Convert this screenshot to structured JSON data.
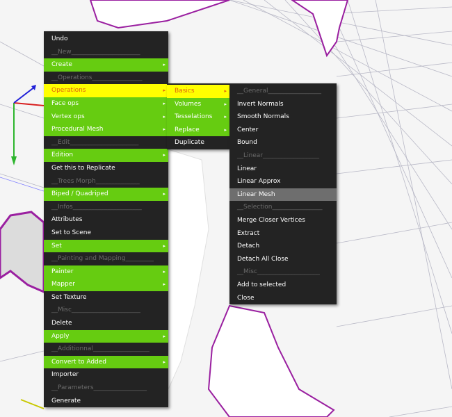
{
  "main_menu": {
    "items": [
      {
        "label": "Undo",
        "style": "normal",
        "arrow": false
      },
      {
        "label": "__New______________________",
        "style": "header",
        "arrow": false
      },
      {
        "label": "Create",
        "style": "green",
        "arrow": true
      },
      {
        "label": "__Operations________________",
        "style": "header",
        "arrow": false
      },
      {
        "label": "Operations",
        "style": "yellow",
        "arrow": true
      },
      {
        "label": "Face ops",
        "style": "green",
        "arrow": true
      },
      {
        "label": "Vertex ops",
        "style": "green",
        "arrow": true
      },
      {
        "label": "Procedural Mesh",
        "style": "green",
        "arrow": true
      },
      {
        "label": "__Edit______________________",
        "style": "header",
        "arrow": false
      },
      {
        "label": "Edition",
        "style": "green",
        "arrow": true
      },
      {
        "label": "Get this to Replicate",
        "style": "normal",
        "arrow": false
      },
      {
        "label": "__Trees Morph______________",
        "style": "header",
        "arrow": false
      },
      {
        "label": "Biped / Quadriped",
        "style": "green",
        "arrow": true
      },
      {
        "label": "__Infos______________________",
        "style": "header",
        "arrow": false
      },
      {
        "label": "Attributes",
        "style": "normal",
        "arrow": false
      },
      {
        "label": "Set to Scene",
        "style": "normal",
        "arrow": false
      },
      {
        "label": "Set",
        "style": "green",
        "arrow": true
      },
      {
        "label": "__Painting and Mapping_________",
        "style": "header",
        "arrow": false
      },
      {
        "label": "Painter",
        "style": "green",
        "arrow": true
      },
      {
        "label": "Mapper",
        "style": "green",
        "arrow": true
      },
      {
        "label": "Set Texture",
        "style": "normal",
        "arrow": false
      },
      {
        "label": "__Misc______________________",
        "style": "header",
        "arrow": false
      },
      {
        "label": "Delete",
        "style": "normal",
        "arrow": false
      },
      {
        "label": "Apply",
        "style": "green",
        "arrow": true
      },
      {
        "label": "__Additionnal__________________",
        "style": "header",
        "arrow": false
      },
      {
        "label": "Convert to Added",
        "style": "green",
        "arrow": true
      },
      {
        "label": "Importer",
        "style": "normal",
        "arrow": false
      },
      {
        "label": "__Parameters_________________",
        "style": "header",
        "arrow": false
      },
      {
        "label": "Generate",
        "style": "normal",
        "arrow": false
      }
    ]
  },
  "sub_menu": {
    "items": [
      {
        "label": "Basics",
        "style": "yellow",
        "arrow": true
      },
      {
        "label": "Volumes",
        "style": "green",
        "arrow": true
      },
      {
        "label": "Tesselations",
        "style": "green",
        "arrow": true
      },
      {
        "label": "Replace",
        "style": "green",
        "arrow": true
      },
      {
        "label": "Duplicate",
        "style": "normal",
        "arrow": false
      }
    ]
  },
  "sub2_menu": {
    "items": [
      {
        "label": "__General_________________",
        "style": "header",
        "arrow": false
      },
      {
        "label": "Invert Normals",
        "style": "normal",
        "arrow": false
      },
      {
        "label": "Smooth Normals",
        "style": "normal",
        "arrow": false
      },
      {
        "label": "Center",
        "style": "normal",
        "arrow": false
      },
      {
        "label": "Bound",
        "style": "normal",
        "arrow": false
      },
      {
        "label": "__Linear__________________",
        "style": "header",
        "arrow": false
      },
      {
        "label": "Linear",
        "style": "normal",
        "arrow": false
      },
      {
        "label": "Linear Approx",
        "style": "normal",
        "arrow": false
      },
      {
        "label": "Linear Mesh",
        "style": "hover",
        "arrow": false
      },
      {
        "label": "__Selection________________",
        "style": "header",
        "arrow": false
      },
      {
        "label": "Merge Closer Vertices",
        "style": "normal",
        "arrow": false
      },
      {
        "label": "Extract",
        "style": "normal",
        "arrow": false
      },
      {
        "label": "Detach",
        "style": "normal",
        "arrow": false
      },
      {
        "label": "Detach All Close",
        "style": "normal",
        "arrow": false
      },
      {
        "label": "__Misc____________________",
        "style": "header",
        "arrow": false
      },
      {
        "label": "Add to selected",
        "style": "normal",
        "arrow": false
      },
      {
        "label": "Close",
        "style": "normal",
        "arrow": false
      }
    ]
  },
  "arrow_glyph": "▸",
  "colors": {
    "menu_bg": "#232323",
    "menu_green": "#66cc11",
    "menu_highlight": "#ffff00",
    "highlight_text": "#e06010",
    "hover_bg": "#6e6e6e",
    "mesh_outline": "#9a1fa0"
  }
}
